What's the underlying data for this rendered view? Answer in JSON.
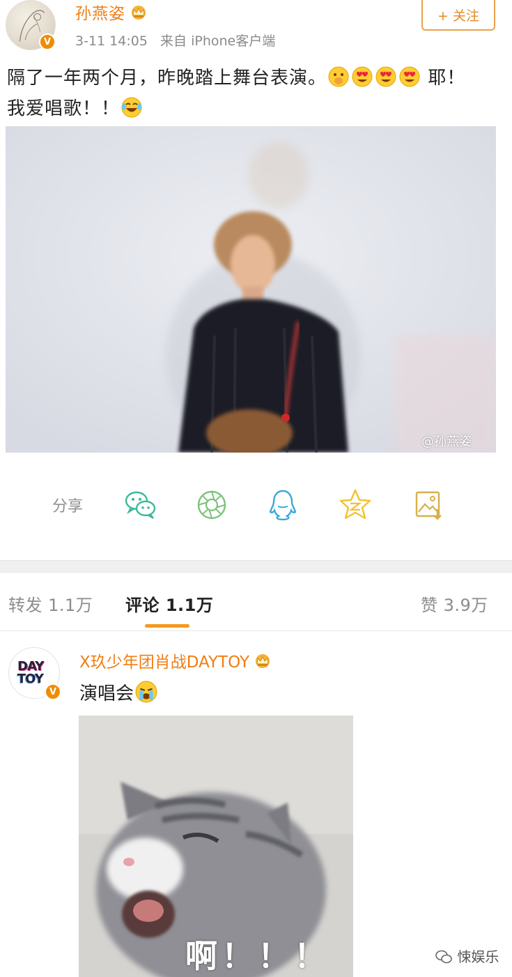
{
  "post": {
    "author": "孙燕姿",
    "timestamp": "3-11 14:05",
    "source": "来自 iPhone客户端",
    "follow_label": "+ 关注",
    "text_line1": "隔了一年两个月，昨晚踏上舞台表演。",
    "text_line1_suffix": "耶！",
    "text_line2": "我爱唱歌！！",
    "watermark": "@孙燕姿"
  },
  "share": {
    "label": "分享",
    "icons": [
      "wechat-icon",
      "moments-icon",
      "qq-icon",
      "qzone-icon",
      "save-image-icon"
    ]
  },
  "tabs": {
    "repost": "转发 1.1万",
    "comments": "评论 1.1万",
    "likes": "赞 3.9万"
  },
  "comment": {
    "author": "X玖少年团肖战DAYTOY",
    "text": "演唱会",
    "avatar_logo_line1": "DAY",
    "avatar_logo_line2": "TOY",
    "image_caption": "啊！！！"
  },
  "footer": {
    "brand": "悚娱乐"
  },
  "colors": {
    "username": "#f07e12",
    "accent": "#f39a1e",
    "verified_badge": "#f08c00"
  }
}
